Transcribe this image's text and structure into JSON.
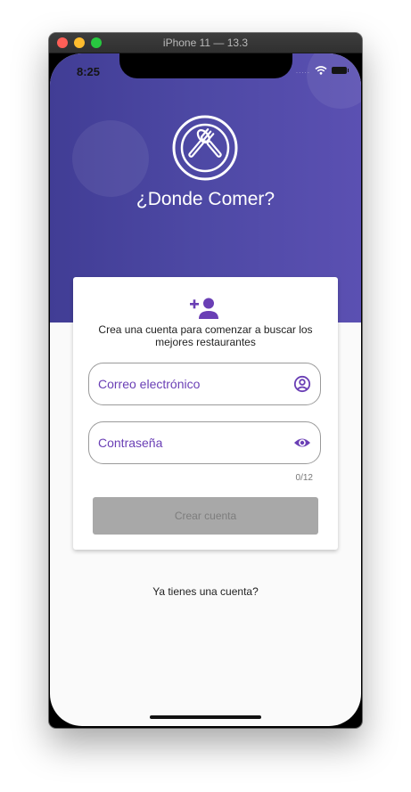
{
  "window": {
    "title": "iPhone 11 — 13.3"
  },
  "status_bar": {
    "time": "8:25",
    "signal": "....."
  },
  "header": {
    "app_title": "¿Donde Comer?"
  },
  "card": {
    "description": "Crea una cuenta para comenzar a buscar los mejores restaurantes",
    "email_placeholder": "Correo electrónico",
    "password_placeholder": "Contraseña",
    "password_counter": "0/12",
    "submit_label": "Crear cuenta"
  },
  "footer": {
    "login_link": "Ya tienes una cuenta?"
  },
  "colors": {
    "header_start": "#413d95",
    "header_end": "#5b50b2",
    "accent": "#6a3fb5",
    "disabled_button": "#a8a8a8"
  },
  "icons": {
    "logo": "plate-fork-spoon-icon",
    "add_user": "person-add-icon",
    "email_field": "account-circle-icon",
    "password_field": "eye-icon",
    "wifi": "wifi-icon",
    "battery": "battery-icon"
  }
}
